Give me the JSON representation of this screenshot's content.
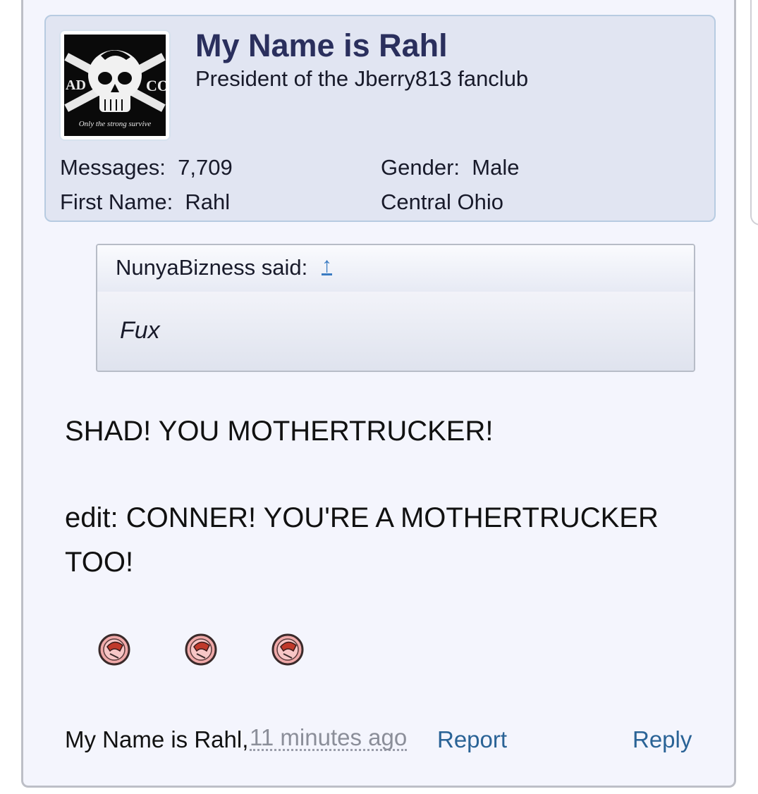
{
  "user": {
    "name": "My Name is Rahl",
    "title": "President of the Jberry813 fanclub",
    "avatar": {
      "icon": "skull-icon",
      "left_text": "AD",
      "right_text": "CO",
      "motto": "Only the strong survive"
    },
    "stats": {
      "messages_label": "Messages:",
      "messages_value": "7,709",
      "first_name_label": "First Name:",
      "first_name_value": "Rahl",
      "gender_label": "Gender:",
      "gender_value": "Male",
      "location": "Central Ohio"
    }
  },
  "quote": {
    "author_text": "NunyaBizness said:",
    "jump_icon": "up-arrow-icon",
    "jump_text": "↑",
    "text": "Fux"
  },
  "message": {
    "line1": "SHAD! YOU MOTHERTRUCKER!",
    "line2": "edit: CONNER! YOU'RE A MOTHERTRUCKER",
    "line3": "TOO!",
    "smileys": [
      "bandaged-face-icon",
      "bandaged-face-icon",
      "bandaged-face-icon"
    ]
  },
  "footer": {
    "author": "My Name is Rahl,",
    "time": "11 minutes ago",
    "report": "Report",
    "reply": "Reply"
  },
  "colors": {
    "post_background": "#f4f5fd",
    "user_box_background": "#e1e5f2",
    "username": "#2a2f5d",
    "link": "#2a6396"
  }
}
